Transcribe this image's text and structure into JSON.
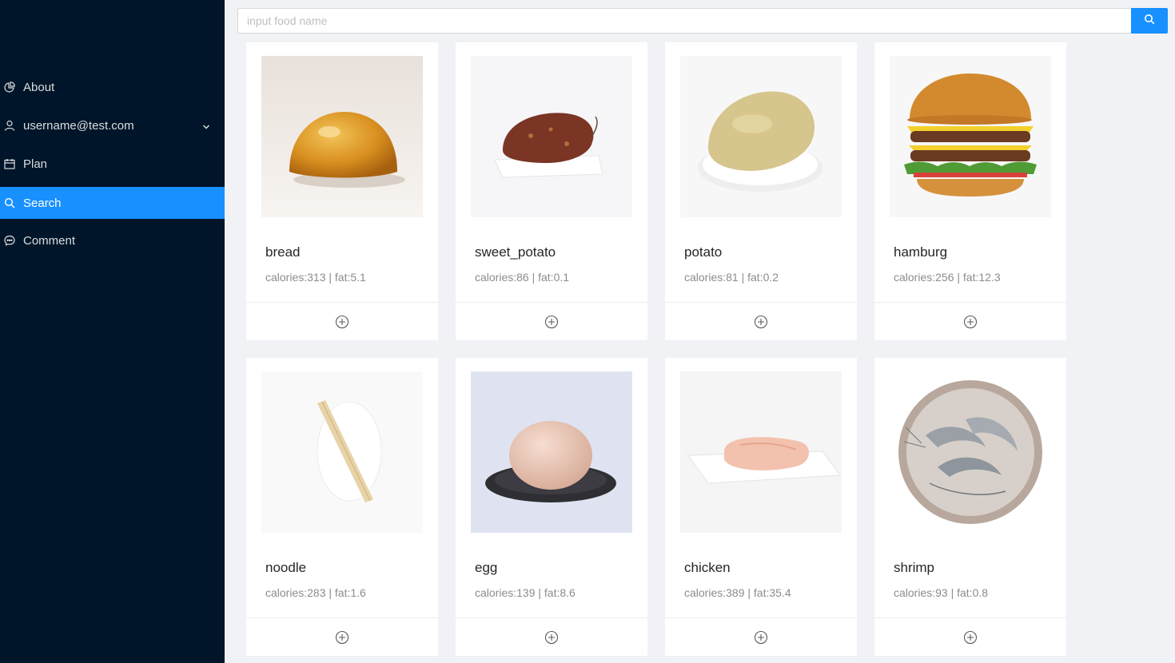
{
  "sidebar": {
    "items": [
      {
        "label": "About",
        "icon": "pie-chart-icon"
      },
      {
        "label": "username@test.com",
        "icon": "user-icon",
        "has_submenu": true
      },
      {
        "label": "Plan",
        "icon": "calendar-icon"
      },
      {
        "label": "Search",
        "icon": "search-icon",
        "selected": true
      },
      {
        "label": "Comment",
        "icon": "comment-icon"
      }
    ]
  },
  "search": {
    "placeholder": "input food name",
    "value": ""
  },
  "foods": [
    {
      "name": "bread",
      "info": "calories:313 | fat:5.1"
    },
    {
      "name": "sweet_potato",
      "info": "calories:86 | fat:0.1"
    },
    {
      "name": "potato",
      "info": "calories:81 | fat:0.2"
    },
    {
      "name": "hamburg",
      "info": "calories:256 | fat:12.3"
    },
    {
      "name": "noodle",
      "info": "calories:283 | fat:1.6"
    },
    {
      "name": "egg",
      "info": "calories:139 | fat:8.6"
    },
    {
      "name": "chicken",
      "info": "calories:389 | fat:35.4"
    },
    {
      "name": "shrimp",
      "info": "calories:93 | fat:0.8"
    }
  ],
  "colors": {
    "sidebar_bg": "#001529",
    "accent": "#1890ff",
    "page_bg": "#f0f2f5"
  }
}
